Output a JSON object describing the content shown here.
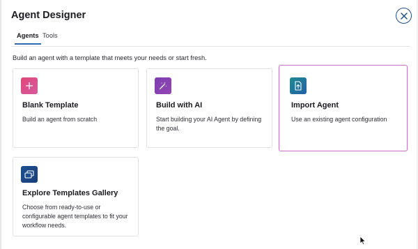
{
  "dialog": {
    "title": "Agent Designer",
    "close_icon": "close-icon"
  },
  "tabs": [
    {
      "label": "Agents",
      "active": true
    },
    {
      "label": "Tools",
      "active": false
    }
  ],
  "subtitle": "Build an agent with a template that meets your needs or start fresh.",
  "cards": [
    {
      "title": "Blank Template",
      "description": "Build an agent from scratch",
      "icon": "plus-icon",
      "icon_color": "#e2467a",
      "selected": false
    },
    {
      "title": "Build with AI",
      "description": "Start building your AI Agent by defining the goal.",
      "icon": "magic-wand-icon",
      "icon_color": "#7b3fb0",
      "selected": false
    },
    {
      "title": "Import Agent",
      "description": "Use an existing agent configuration",
      "icon": "import-file-icon",
      "icon_color": "#1f8a8f",
      "selected": true
    },
    {
      "title": "Explore Templates Gallery",
      "description": "Choose from ready-to-use or configurable agent templates to fit your workflow needs.",
      "icon": "gallery-icon",
      "icon_color": "#1d4f8e",
      "selected": false
    }
  ],
  "colors": {
    "accent": "#2d6ab0",
    "selected_border": "#c970c8"
  }
}
